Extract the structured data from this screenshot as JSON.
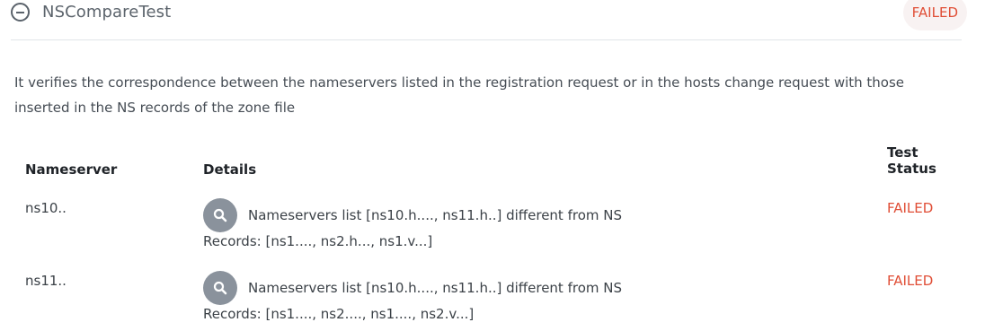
{
  "header": {
    "test_name": "NSCompareTest",
    "status": "FAILED"
  },
  "description": "It verifies the correspondence between the nameservers listed in the registration request or in the hosts change request with those inserted in the NS records of the zone file",
  "table": {
    "columns": {
      "nameserver": "Nameserver",
      "details": "Details",
      "status_line1": "Test",
      "status_line2": "Status"
    },
    "rows": [
      {
        "nameserver": "ns10..",
        "details_line1": "Nameservers list [ns10.h...., ns11.h..] different from NS",
        "details_line2": "Records: [ns1...., ns2.h..., ns1.v...]",
        "status": "FAILED"
      },
      {
        "nameserver": "ns11..",
        "details_line1": "Nameservers list [ns10.h...., ns11.h..] different from NS",
        "details_line2": "Records: [ns1...., ns2...., ns1...., ns2.v...]",
        "status": "FAILED"
      }
    ]
  },
  "colors": {
    "failed": "#e04e36",
    "status_pill_bg": "#f8f2f2",
    "search_button": "#8a929c"
  },
  "icons": {
    "collapse": "minus-circle-icon",
    "details": "search-icon"
  }
}
